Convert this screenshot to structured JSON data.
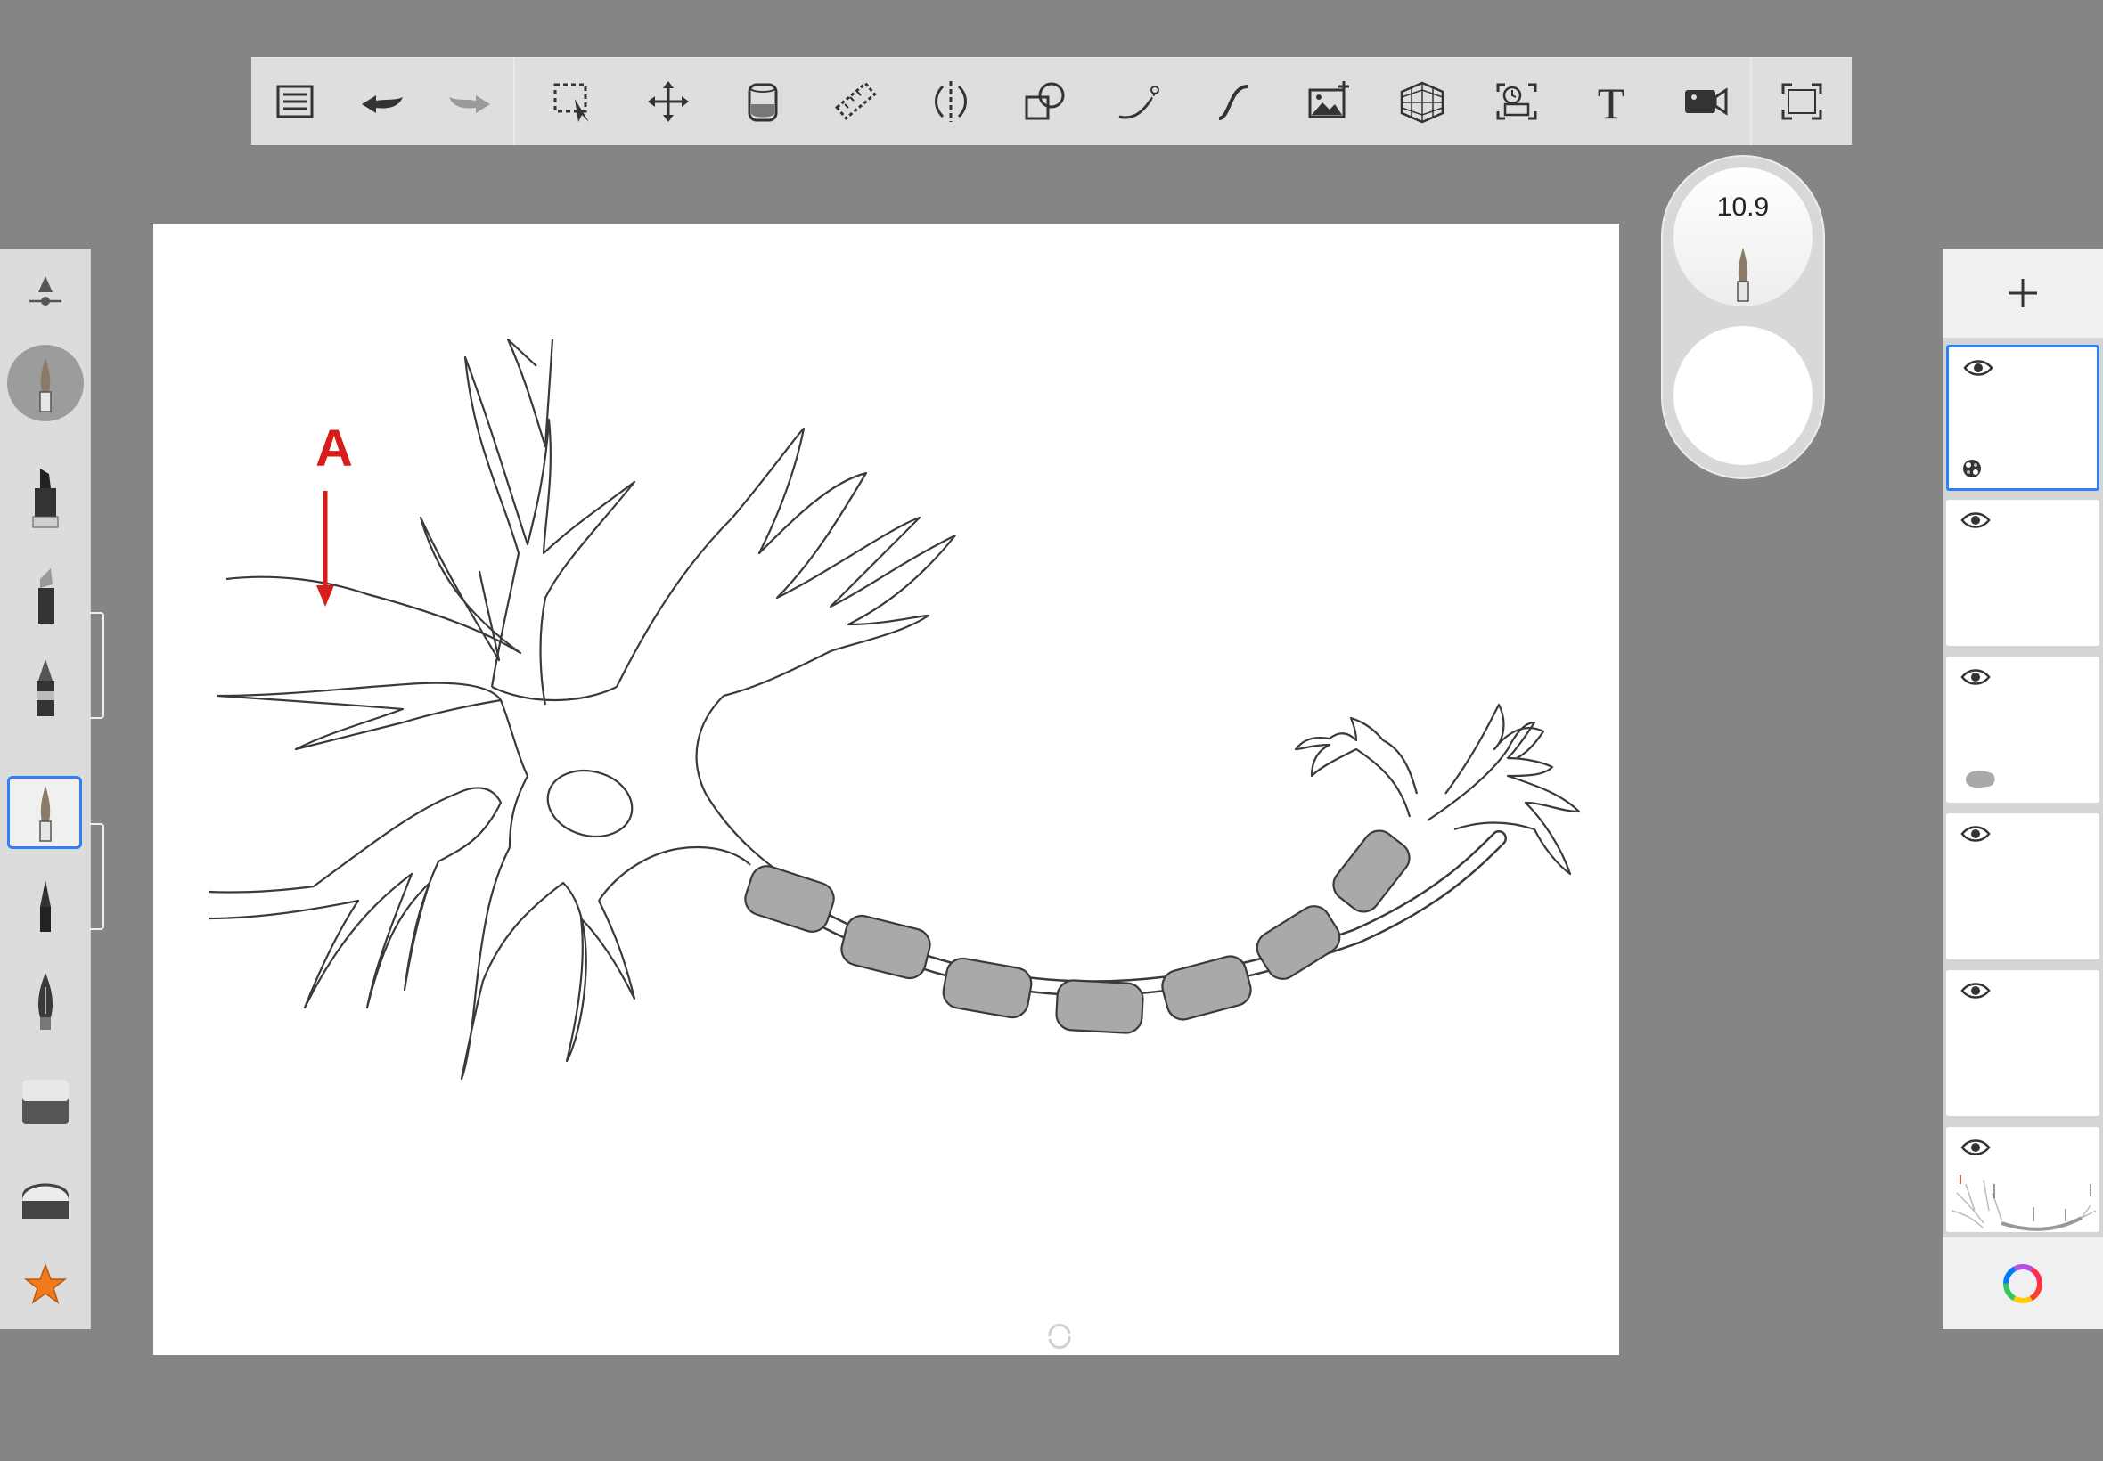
{
  "toolbar": {
    "items": [
      {
        "name": "layer-list-icon"
      },
      {
        "name": "undo-icon"
      },
      {
        "name": "redo-icon"
      },
      {
        "name": "selection-icon"
      },
      {
        "name": "transform-icon"
      },
      {
        "name": "fill-bucket-icon"
      },
      {
        "name": "ruler-icon"
      },
      {
        "name": "symmetry-icon"
      },
      {
        "name": "shape-icon"
      },
      {
        "name": "stroke-ruler-icon"
      },
      {
        "name": "curve-icon"
      },
      {
        "name": "image-import-icon"
      },
      {
        "name": "perspective-grid-icon"
      },
      {
        "name": "time-lapse-icon"
      },
      {
        "name": "text-icon"
      },
      {
        "name": "record-video-icon"
      },
      {
        "name": "fullscreen-icon"
      }
    ],
    "text_tool_label": "T"
  },
  "brush": {
    "size": "10.9",
    "selected": "paintbrush"
  },
  "canvas": {
    "annotation_label": "A",
    "annotation_color": "#d81b1b",
    "myelin_color": "#a9a9ab"
  },
  "left_tools": [
    {
      "name": "brush-properties-icon"
    },
    {
      "name": "airbrush-icon"
    },
    {
      "name": "marker-icon"
    },
    {
      "name": "chisel-marker-icon"
    },
    {
      "name": "ballpoint-pen-icon"
    },
    {
      "name": "paintbrush-icon"
    },
    {
      "name": "fineliner-icon"
    },
    {
      "name": "ink-pen-icon"
    },
    {
      "name": "eraser-icon"
    },
    {
      "name": "soft-eraser-icon"
    },
    {
      "name": "favorites-star-icon"
    }
  ],
  "layers": {
    "count": 6,
    "active_index": 0,
    "accent": "#2f7ff5"
  }
}
